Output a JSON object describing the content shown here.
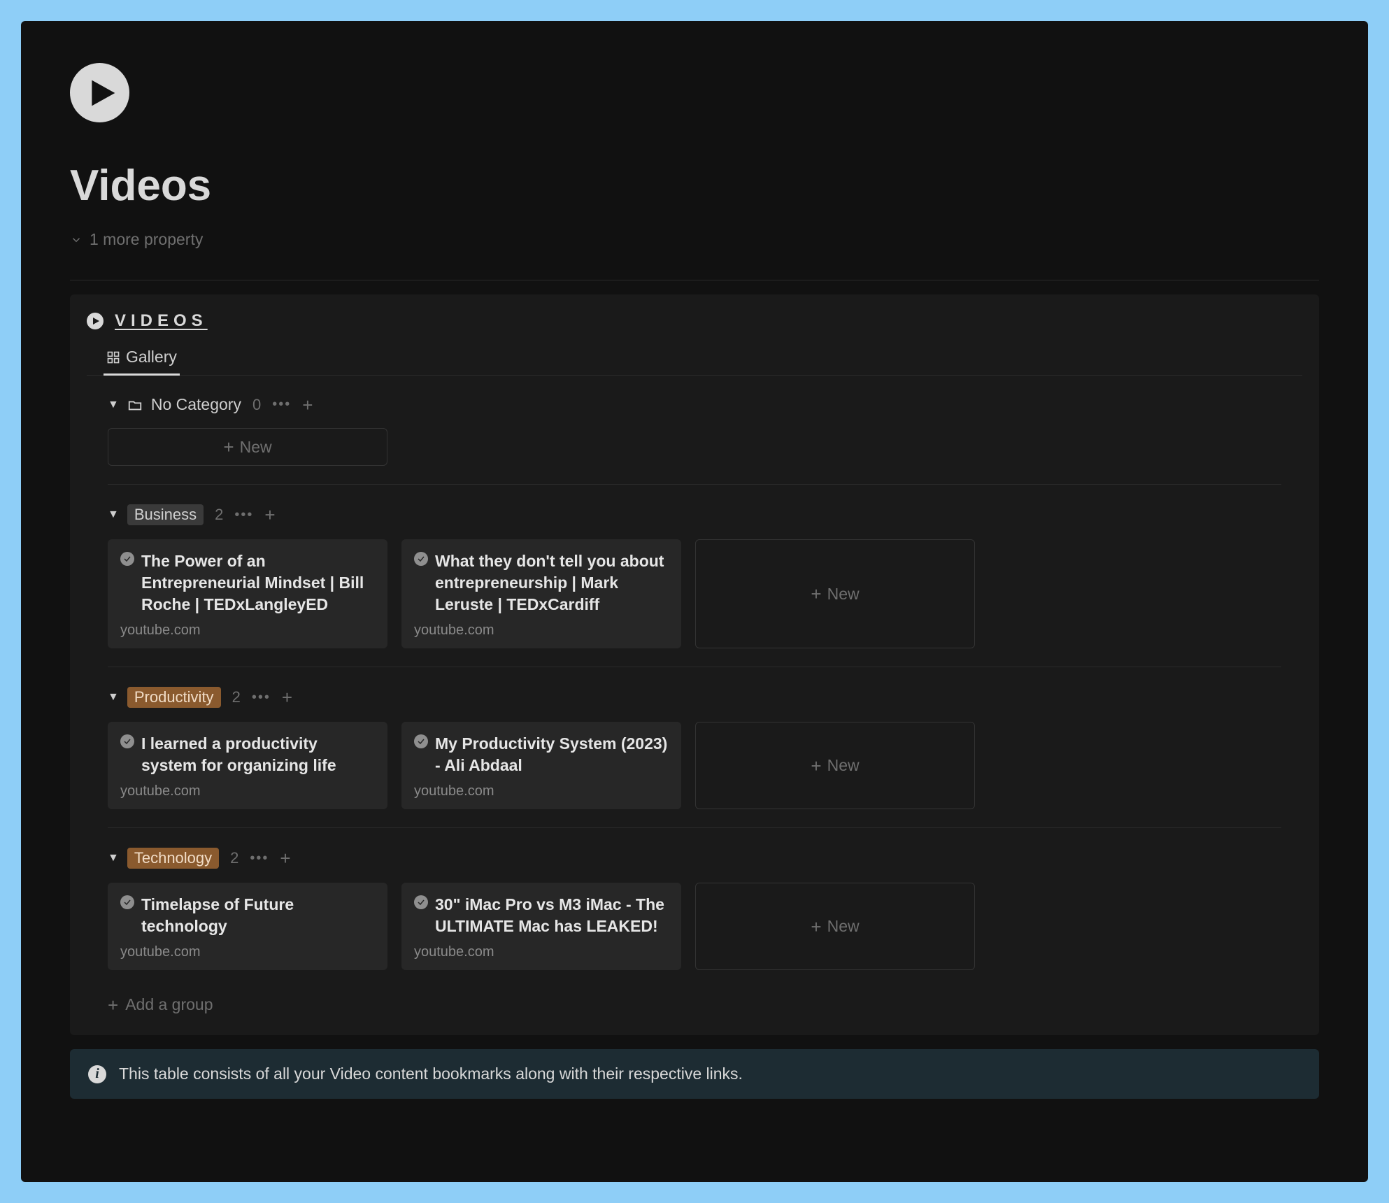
{
  "page": {
    "title": "Videos",
    "more_property": "1 more property"
  },
  "database": {
    "title": "VIDEOS",
    "view_tab": "Gallery",
    "add_group": "Add a group",
    "new_label": "New"
  },
  "groups": {
    "nocat": {
      "name": "No Category",
      "count": "0"
    },
    "business": {
      "name": "Business",
      "count": "2"
    },
    "productivity": {
      "name": "Productivity",
      "count": "2"
    },
    "technology": {
      "name": "Technology",
      "count": "2"
    }
  },
  "cards": {
    "biz1": {
      "title": "The Power of an Entrepreneurial Mindset | Bill Roche | TEDxLangleyED",
      "source": "youtube.com"
    },
    "biz2": {
      "title": "What they don't tell you about entrepreneurship | Mark Leruste | TEDxCardiff",
      "source": "youtube.com"
    },
    "prod1": {
      "title": "I learned a productivity system for organizing life",
      "source": "youtube.com"
    },
    "prod2": {
      "title": "My Productivity System (2023) - Ali Abdaal",
      "source": "youtube.com"
    },
    "tech1": {
      "title": "Timelapse of Future technology",
      "source": "youtube.com"
    },
    "tech2": {
      "title": "30\" iMac Pro vs M3 iMac - The ULTIMATE Mac has LEAKED!",
      "source": "youtube.com"
    }
  },
  "info": {
    "text": "This table consists of all your Video content bookmarks along with their respective links."
  }
}
